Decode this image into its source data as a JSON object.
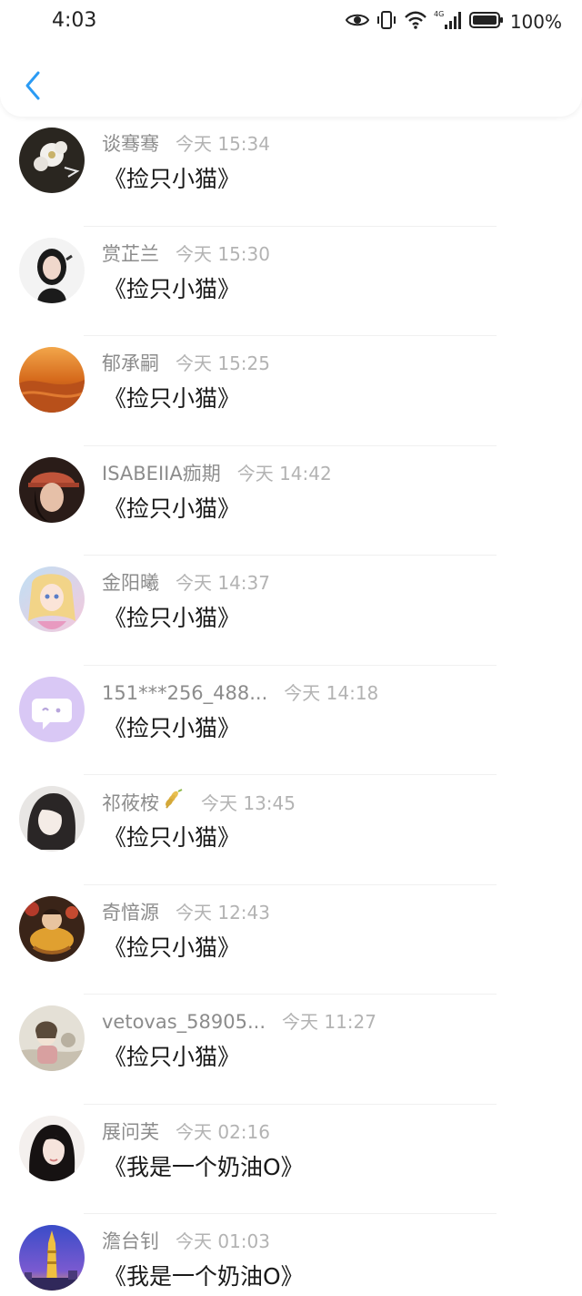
{
  "status_bar": {
    "time": "4:03",
    "network": "4G",
    "battery": "100%"
  },
  "header": {
    "back_icon": "chevron-left-icon",
    "accent_color": "#2b9bf4"
  },
  "messages": [
    {
      "name": "谈骞骞",
      "time": "今天 15:34",
      "text": "《捡只小猫》"
    },
    {
      "name": "赏芷兰",
      "time": "今天 15:30",
      "text": "《捡只小猫》"
    },
    {
      "name": "郁承嗣",
      "time": "今天 15:25",
      "text": "《捡只小猫》"
    },
    {
      "name": "ISABEIIA痂期",
      "time": "今天 14:42",
      "text": "《捡只小猫》"
    },
    {
      "name": "金阳曦",
      "time": "今天 14:37",
      "text": "《捡只小猫》"
    },
    {
      "name": "151***256_488...",
      "time": "今天 14:18",
      "text": "《捡只小猫》"
    },
    {
      "name": "祁莜桉",
      "time": "今天 13:45",
      "text": "《捡只小猫》"
    },
    {
      "name": "奇愔源",
      "time": "今天 12:43",
      "text": "《捡只小猫》"
    },
    {
      "name": "vetovas_58905...",
      "time": "今天 11:27",
      "text": "《捡只小猫》"
    },
    {
      "name": "展问芙",
      "time": "今天 02:16",
      "text": "《我是一个奶油O》"
    },
    {
      "name": "澹台钊",
      "time": "今天 01:03",
      "text": "《我是一个奶油O》"
    }
  ]
}
